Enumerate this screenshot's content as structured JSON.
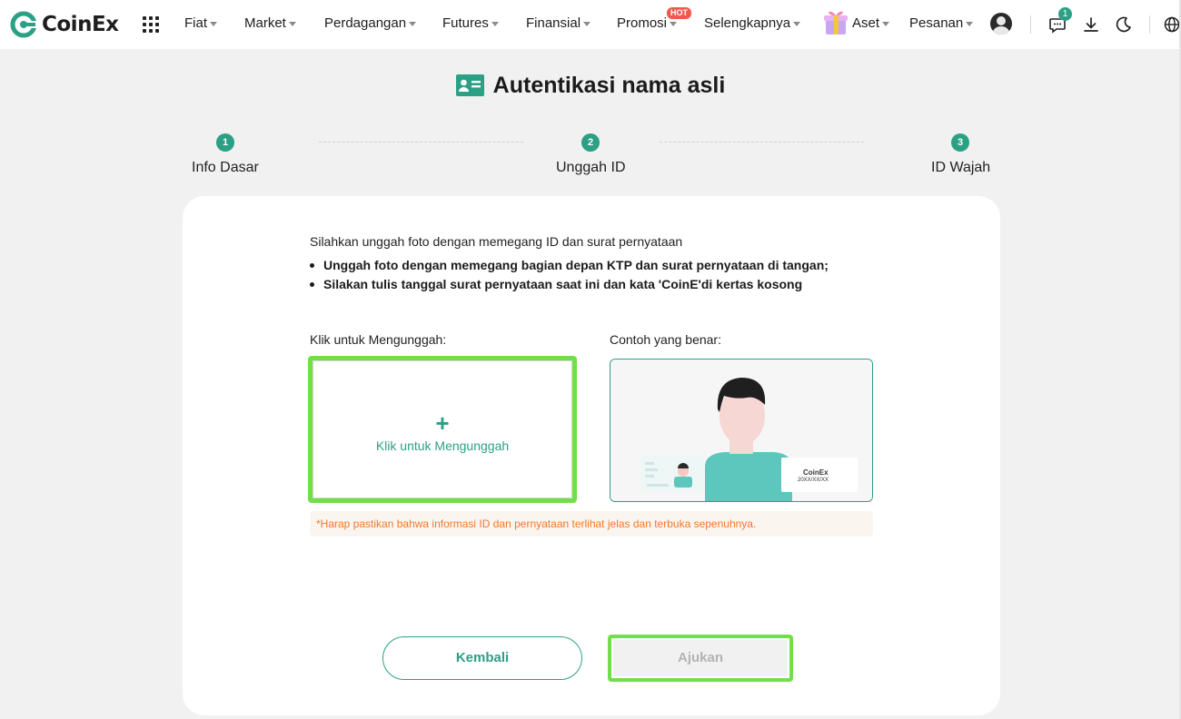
{
  "brand": {
    "name": "CoinEx",
    "accent": "#2ba085",
    "highlight": "#71e046"
  },
  "nav": {
    "items": [
      {
        "label": "Fiat"
      },
      {
        "label": "Market"
      },
      {
        "label": "Perdagangan"
      },
      {
        "label": "Futures"
      },
      {
        "label": "Finansial"
      },
      {
        "label": "Promosi"
      },
      {
        "label": "Selengkapnya"
      },
      {
        "label": "Aset"
      },
      {
        "label": "Pesanan"
      }
    ],
    "hot_badge": "HOT",
    "chat_count": "1",
    "icons": [
      "apps-grid-icon",
      "gift-icon",
      "avatar",
      "chat-icon",
      "download-icon",
      "moon-icon",
      "globe-icon"
    ]
  },
  "page": {
    "title": "Autentikasi nama asli",
    "title_icon": "id-card-icon"
  },
  "stepper": {
    "steps": [
      {
        "number": "1",
        "label": "Info Dasar"
      },
      {
        "number": "2",
        "label": "Unggah ID"
      },
      {
        "number": "3",
        "label": "ID Wajah"
      }
    ]
  },
  "form": {
    "intro": "Silahkan unggah foto dengan memegang ID dan surat pernyataan",
    "bullets": [
      "Unggah foto dengan memegang bagian depan KTP dan surat pernyataan di tangan;",
      "Silakan tulis tanggal surat pernyataan saat ini dan kata 'CoinE'di kertas kosong"
    ],
    "upload_label": "Klik untuk Mengunggah:",
    "upload_button_text": "Klik untuk Mengunggah",
    "example_label": "Contoh yang benar:",
    "example_note_brand": "CoinEx",
    "example_note_date": "20XX/XX/XX",
    "warning": "*Harap pastikan bahwa informasi ID dan pernyataan terlihat jelas dan terbuka sepenuhnya."
  },
  "actions": {
    "back": "Kembali",
    "submit": "Ajukan"
  }
}
